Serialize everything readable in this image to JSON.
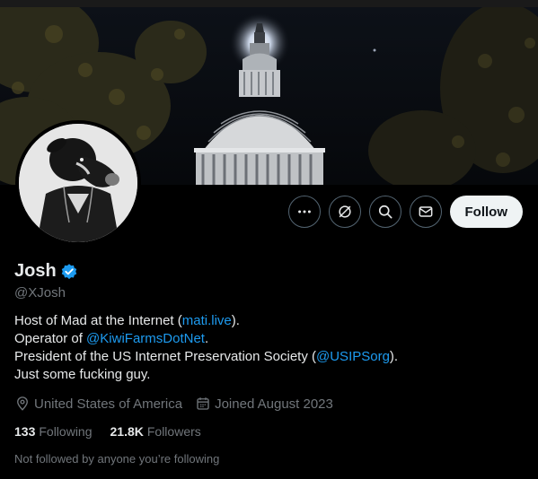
{
  "profile": {
    "name": "Josh",
    "handle": "@XJosh",
    "follow_label": "Follow",
    "bio": {
      "line1_pre": "Host of Mad at the Internet (",
      "line1_link": "mati.live",
      "line1_post": ").",
      "line2_pre": "Operator of ",
      "line2_link": "@KiwiFarmsDotNet",
      "line2_post": ".",
      "line3_pre": "President of the US Internet Preservation Society (",
      "line3_link": "@USIPSorg",
      "line3_post": ").",
      "line4": "Just some fucking guy."
    },
    "location": "United States of America",
    "joined": "Joined August 2023",
    "following_count": "133",
    "following_label": "Following",
    "followers_count": "21.8K",
    "followers_label": "Followers",
    "followed_by_note": "Not followed by anyone you’re following"
  },
  "icons": {
    "more": "more-icon",
    "grok": "grok-icon",
    "search": "search-icon",
    "message": "message-icon",
    "verified": "verified-badge-icon",
    "location": "location-pin-icon",
    "calendar": "calendar-icon"
  },
  "colors": {
    "background": "#000000",
    "link": "#1d9bf0",
    "muted": "#71767b",
    "follow_button": "#eff3f4"
  }
}
